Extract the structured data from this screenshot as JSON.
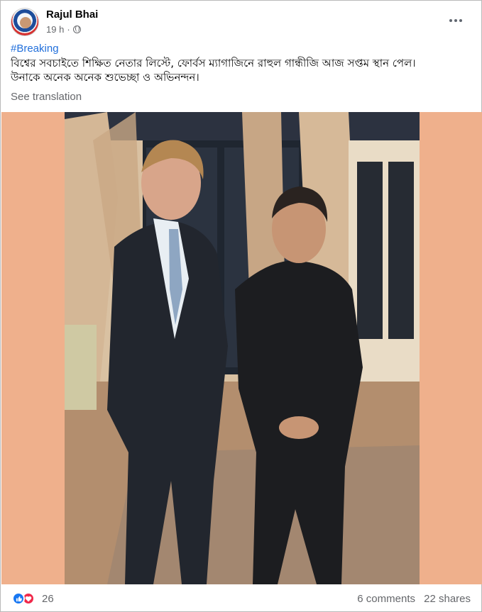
{
  "post": {
    "author": "Rajul Bhai",
    "time": "19 h",
    "privacy_icon": "globe-icon",
    "hashtag": "#Breaking",
    "text_line1": "বিশ্বের সবচাইতে শিক্ষিত নেতার লিস্টে, ফোর্বস ম্যাগাজিনে রাহুল গান্ধীজি আজ সপ্তম স্থান পেল।",
    "text_line2": "উনাকে অনেক অনেক শুভেচ্ছা ও অভিনন্দন।",
    "see_translation": "See translation"
  },
  "footer": {
    "reaction_icons": [
      "like-icon",
      "love-icon"
    ],
    "reaction_count": "26",
    "comments": "6 comments",
    "shares": "22 shares"
  },
  "colors": {
    "photo_background": "#efb08c",
    "link": "#216fdb",
    "secondary_text": "#65676b",
    "like": "#1877f2",
    "love": "#f0284a"
  }
}
